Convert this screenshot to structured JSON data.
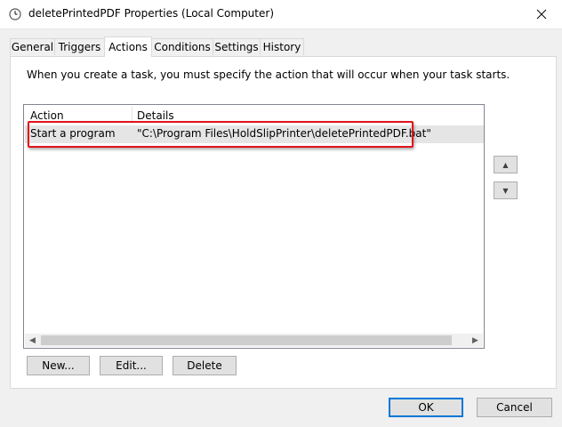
{
  "window": {
    "title": "deletePrintedPDF Properties (Local Computer)"
  },
  "tabs": [
    {
      "label": "General"
    },
    {
      "label": "Triggers"
    },
    {
      "label": "Actions"
    },
    {
      "label": "Conditions"
    },
    {
      "label": "Settings"
    },
    {
      "label": "History"
    }
  ],
  "active_tab": "Actions",
  "actions_panel": {
    "instruction": "When you create a task, you must specify the action that will occur when your task starts.",
    "columns": [
      "Action",
      "Details"
    ],
    "rows": [
      {
        "action": "Start a program",
        "details": "\"C:\\Program Files\\HoldSlipPrinter\\deletePrintedPDF.bat\""
      }
    ],
    "buttons": {
      "new_label": "New...",
      "edit_label": "Edit...",
      "delete_label": "Delete"
    }
  },
  "footer": {
    "ok_label": "OK",
    "cancel_label": "Cancel"
  },
  "colors": {
    "highlight_border": "#e0141b",
    "default_button_border": "#0078d7"
  }
}
